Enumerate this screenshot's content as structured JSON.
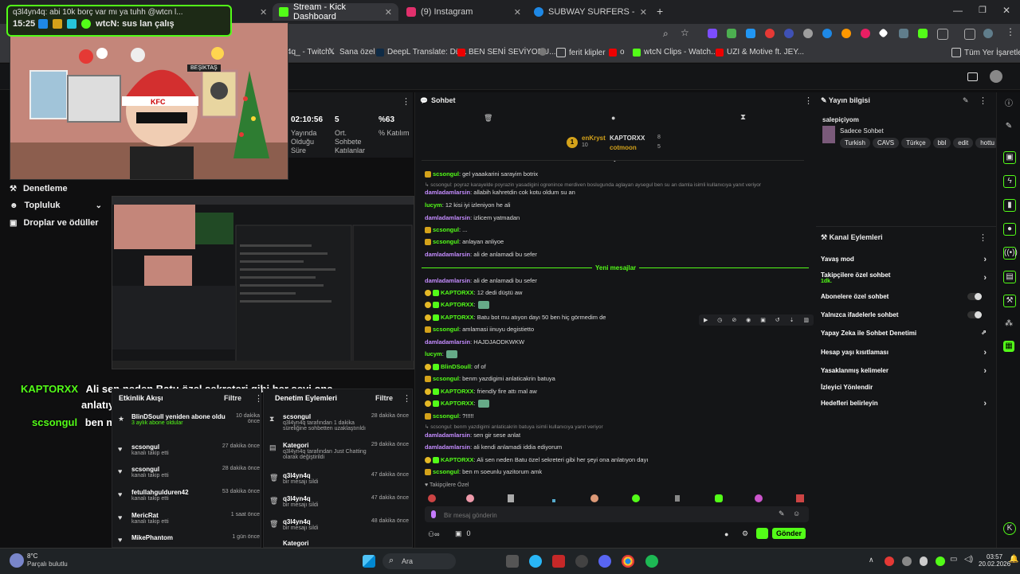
{
  "browser": {
    "tabs": [
      {
        "label": "Stream - Kick Dashboard",
        "active": true
      },
      {
        "label": "(9) Instagram",
        "active": false
      },
      {
        "label": "SUBWAY SURFERS - Ücretsiz Oy...",
        "active": false
      }
    ],
    "bookmarks": [
      "4q_ - Twitch",
      "Sana özel",
      "DeepL Translate: Dü...",
      "BEN SENİ SEVİYORU...",
      "o",
      "ferit klipler",
      "o",
      "wtcN Clips - Watch...",
      "UZI & Motive ft. JEY...",
      "Tüm Yer İşaretleri"
    ]
  },
  "overlay": {
    "chat_popup_line1": "q3l4yn4q: abi 10k borç var mı ya tuhh @wtcn l...",
    "chat_popup_time": "15:25",
    "chat_popup_line2": "wtcN: sus lan çalış",
    "cam_text1": "BEŞİKTAŞ",
    "cam_text2": "KFC",
    "caption1_user": "KAPTORXX",
    "caption1_text": "Ali sen neden Batu özel sekreteri gibi her şeyi ona",
    "caption1_text2": "anlatıyon dayı",
    "caption2_user": "scsongul",
    "caption2_text": "ben m soeunlu yazitorum amk"
  },
  "stats": [
    {
      "value": "02:10:56",
      "label": "Yayında Olduğu Süre"
    },
    {
      "value": "5",
      "label": "Ort. Sohbete Katılanlar"
    },
    {
      "value": "%63",
      "label": "% Katılım"
    }
  ],
  "nav": {
    "items": [
      "Denetleme",
      "Topluluk",
      "Droplar ve ödüller"
    ]
  },
  "activity": {
    "title": "Etkinlik Akışı",
    "filter": "Filtre",
    "items": [
      {
        "name": "BlinDSoull yeniden abone oldu",
        "sub": "3 aylık abone oldular",
        "time": "10 dakika önce"
      },
      {
        "name": "scsongul",
        "sub": "kanalı takip etti",
        "time": "27 dakika önce"
      },
      {
        "name": "scsongul",
        "sub": "kanalı takip etti",
        "time": "28 dakika önce"
      },
      {
        "name": "fetullahgulduren42",
        "sub": "kanalı takip etti",
        "time": "53 dakika önce"
      },
      {
        "name": "MericRat",
        "sub": "kanalı takip etti",
        "time": "1 saat önce"
      },
      {
        "name": "MikePhantom",
        "sub": "",
        "time": "1 gün önce"
      }
    ]
  },
  "moderation": {
    "title": "Denetim Eylemleri",
    "filter": "Filtre",
    "items": [
      {
        "name": "scsongul",
        "sub": "q3l4yn4q tarafından 1 dakika süreliğine sohbetten uzaklaştırıldı",
        "time": "28 dakika önce"
      },
      {
        "name": "Kategori",
        "sub": "q3l4yn4q tarafından Just Chatting olarak değiştirildi",
        "time": "29 dakika önce"
      },
      {
        "name": "q3l4yn4q",
        "sub": "bir mesajı sildi",
        "time": "47 dakika önce"
      },
      {
        "name": "q3l4yn4q",
        "sub": "bir mesajı sildi",
        "time": "47 dakika önce"
      },
      {
        "name": "q3l4yn4q",
        "sub": "bir mesajı sildi",
        "time": "48 dakika önce"
      },
      {
        "name": "Kategori",
        "sub": "",
        "time": ""
      }
    ]
  },
  "chat": {
    "title": "Sohbet",
    "leaderboard": [
      {
        "name": "enKryst",
        "count": "10"
      },
      {
        "name": "KAPTORXX",
        "count": "8"
      },
      {
        "name": "cotmoon",
        "count": "5"
      }
    ],
    "new_messages_label": "Yeni mesajlar",
    "messages": [
      {
        "user": "scsongul",
        "text": ": gel yaaakarini sarayim botrix",
        "color": "#53fc18",
        "badge": "gold"
      },
      {
        "user": "",
        "text": "scsongul: poyraz karayelde poyrazin yasadigini ogrenince merdiven boslugunda aglayan aysegul ben su an damla isimli kullanıcıya yanıt veriyor",
        "color": "#888",
        "badge": "reply"
      },
      {
        "user": "damladamlarsin",
        "text": ": allabih kahretdin cok kotu oldum su an",
        "color": "#c48cff",
        "badge": ""
      },
      {
        "user": "lucym",
        "text": ": 12 kisi iyi izleniyon he ali",
        "color": "#53fc18",
        "badge": ""
      },
      {
        "user": "damladamlarsin",
        "text": ": izlicem yatmadan",
        "color": "#c48cff",
        "badge": ""
      },
      {
        "user": "scsongul",
        "text": ": ...",
        "color": "#53fc18",
        "badge": "gold"
      },
      {
        "user": "scsongul",
        "text": ": anlayan anliyoe",
        "color": "#53fc18",
        "badge": "gold"
      },
      {
        "user": "damladamlarsin",
        "text": ": ali de anlamadi bu sefer",
        "color": "#c48cff",
        "badge": ""
      },
      {
        "user": "damladamlarsin",
        "text": ": ali de anlamadi bu sefer",
        "color": "#c48cff",
        "badge": ""
      },
      {
        "user": "KAPTORXX",
        "text": ": 12 dedi düştü aw",
        "color": "#53fc18",
        "badge": "double"
      },
      {
        "user": "KAPTORXX",
        "text": ":",
        "color": "#53fc18",
        "badge": "double"
      },
      {
        "user": "KAPTORXX",
        "text": ": Batu bot mu atıyon dayı 50 ben hiç görmedim de",
        "color": "#53fc18",
        "badge": "double"
      },
      {
        "user": "scsongul",
        "text": ": amlamasi iinuyu degistietto",
        "color": "#53fc18",
        "badge": "gold"
      },
      {
        "user": "damladamlarsin",
        "text": ": HAJDJAODKWKW",
        "color": "#c48cff",
        "badge": ""
      },
      {
        "user": "lucym",
        "text": ":",
        "color": "#53fc18",
        "badge": ""
      },
      {
        "user": "BlinDSoull",
        "text": ": of of",
        "color": "#53fc18",
        "badge": "double"
      },
      {
        "user": "scsongul",
        "text": ": benm yazdigimi anlaticakrin batuya",
        "color": "#53fc18",
        "badge": "gold"
      },
      {
        "user": "KAPTORXX",
        "text": ": friendly fire attı mal aw",
        "color": "#53fc18",
        "badge": "double"
      },
      {
        "user": "KAPTORXX",
        "text": ":",
        "color": "#53fc18",
        "badge": "double"
      },
      {
        "user": "scsongul",
        "text": ": ?!!!!!",
        "color": "#53fc18",
        "badge": "gold"
      },
      {
        "user": "",
        "text": "scsongul: benm yazdigimi anlaticakrin batuya isimli kullanıcıya yanıt veriyor",
        "color": "#888",
        "badge": "reply"
      },
      {
        "user": "damladamlarsin",
        "text": ": sen gir sese anlat",
        "color": "#c48cff",
        "badge": ""
      },
      {
        "user": "damladamlarsin",
        "text": ": ali kendi anlamadi iddia ediyorum",
        "color": "#c48cff",
        "badge": ""
      },
      {
        "user": "KAPTORXX",
        "text": ": Ali sen neden Batu özel sekreteri gibi her şeyi ona anlatıyon dayı",
        "color": "#53fc18",
        "badge": "double"
      },
      {
        "user": "scsongul",
        "text": ": ben m soeunlu yazitorum amk",
        "color": "#53fc18",
        "badge": "gold"
      }
    ],
    "followers_only_label": "Takipçilere Özel",
    "input_placeholder": "Bir mesaj gönderin",
    "send_label": "Gönder",
    "kick_count": "0"
  },
  "stream_info": {
    "title": "Yayın bilgisi",
    "stream_title": "salepiçiyom",
    "category": "Sadece Sohbet",
    "tags": [
      "Turkish",
      "CAVS",
      "Türkçe",
      "bbl",
      "edit",
      "hottu"
    ]
  },
  "channel_actions": {
    "title": "Kanal Eylemleri",
    "items": [
      {
        "label": "Yavaş mod",
        "sub": "",
        "control": "chevron"
      },
      {
        "label": "Takipçilere özel sohbet",
        "sub": "1dk.",
        "control": "chevron"
      },
      {
        "label": "Abonelere özel sohbet",
        "sub": "",
        "control": "toggle"
      },
      {
        "label": "Yalnızca ifadelerle sohbet",
        "sub": "",
        "control": "toggle"
      },
      {
        "label": "Yapay Zeka ile Sohbet Denetimi",
        "sub": "",
        "control": "external"
      },
      {
        "label": "Hesap yaşı kısıtlaması",
        "sub": "",
        "control": "chevron"
      },
      {
        "label": "Yasaklanmış kelimeler",
        "sub": "",
        "control": "chevron"
      },
      {
        "label": "İzleyici Yönlendir",
        "sub": "",
        "control": "none"
      },
      {
        "label": "Hedefleri belirleyin",
        "sub": "",
        "control": "chevron"
      }
    ]
  },
  "taskbar": {
    "weather_temp": "8°C",
    "weather_desc": "Parçalı bulutlu",
    "search_label": "Ara",
    "time": "03:57",
    "date": "20.02.2026"
  },
  "colors": {
    "accent": "#53fc18",
    "purple_user": "#c48cff"
  }
}
